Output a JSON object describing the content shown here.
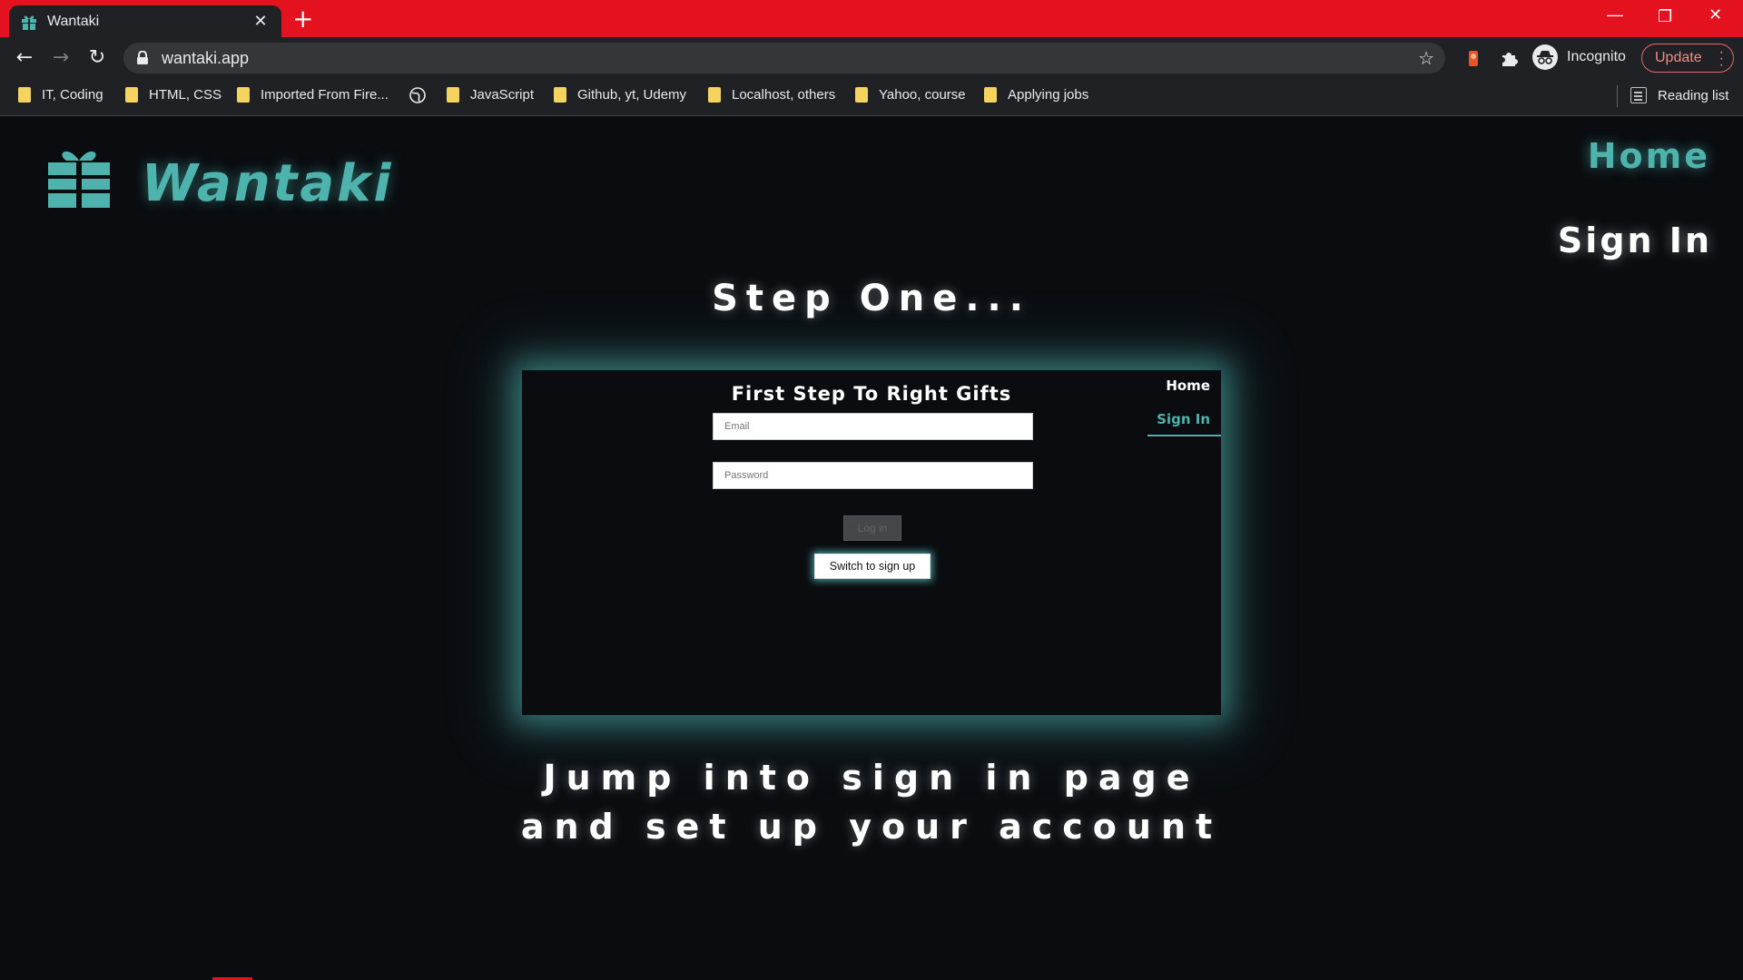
{
  "browser": {
    "tab_title": "Wantaki",
    "url": "wantaki.app",
    "profile_label": "Incognito",
    "update_label": "Update",
    "reading_list_label": "Reading list",
    "bookmarks": [
      {
        "label": "IT, Coding"
      },
      {
        "label": "HTML, CSS"
      },
      {
        "label": "Imported From Fire..."
      },
      {
        "label": "JavaScript"
      },
      {
        "label": "Github, yt, Udemy"
      },
      {
        "label": "Localhost, others"
      },
      {
        "label": "Yahoo, course"
      },
      {
        "label": "Applying jobs"
      }
    ],
    "colors": {
      "tabbar": "#e4121f",
      "chrome": "#202124"
    }
  },
  "site": {
    "logo_text": "Wantaki",
    "nav": {
      "home": "Home",
      "sign_in": "Sign In"
    },
    "step_title": "Step One...",
    "preview": {
      "title": "First Step To Right Gifts",
      "email_placeholder": "Email",
      "password_placeholder": "Password",
      "login_label": "Log in",
      "switch_label": "Switch to sign up",
      "nav_home": "Home",
      "nav_sign_in": "Sign In"
    },
    "caption_line1": "Jump into sign in page",
    "caption_line2": "and set up your account",
    "colors": {
      "accent": "#4fb3ad",
      "background": "#0a0c10"
    }
  }
}
